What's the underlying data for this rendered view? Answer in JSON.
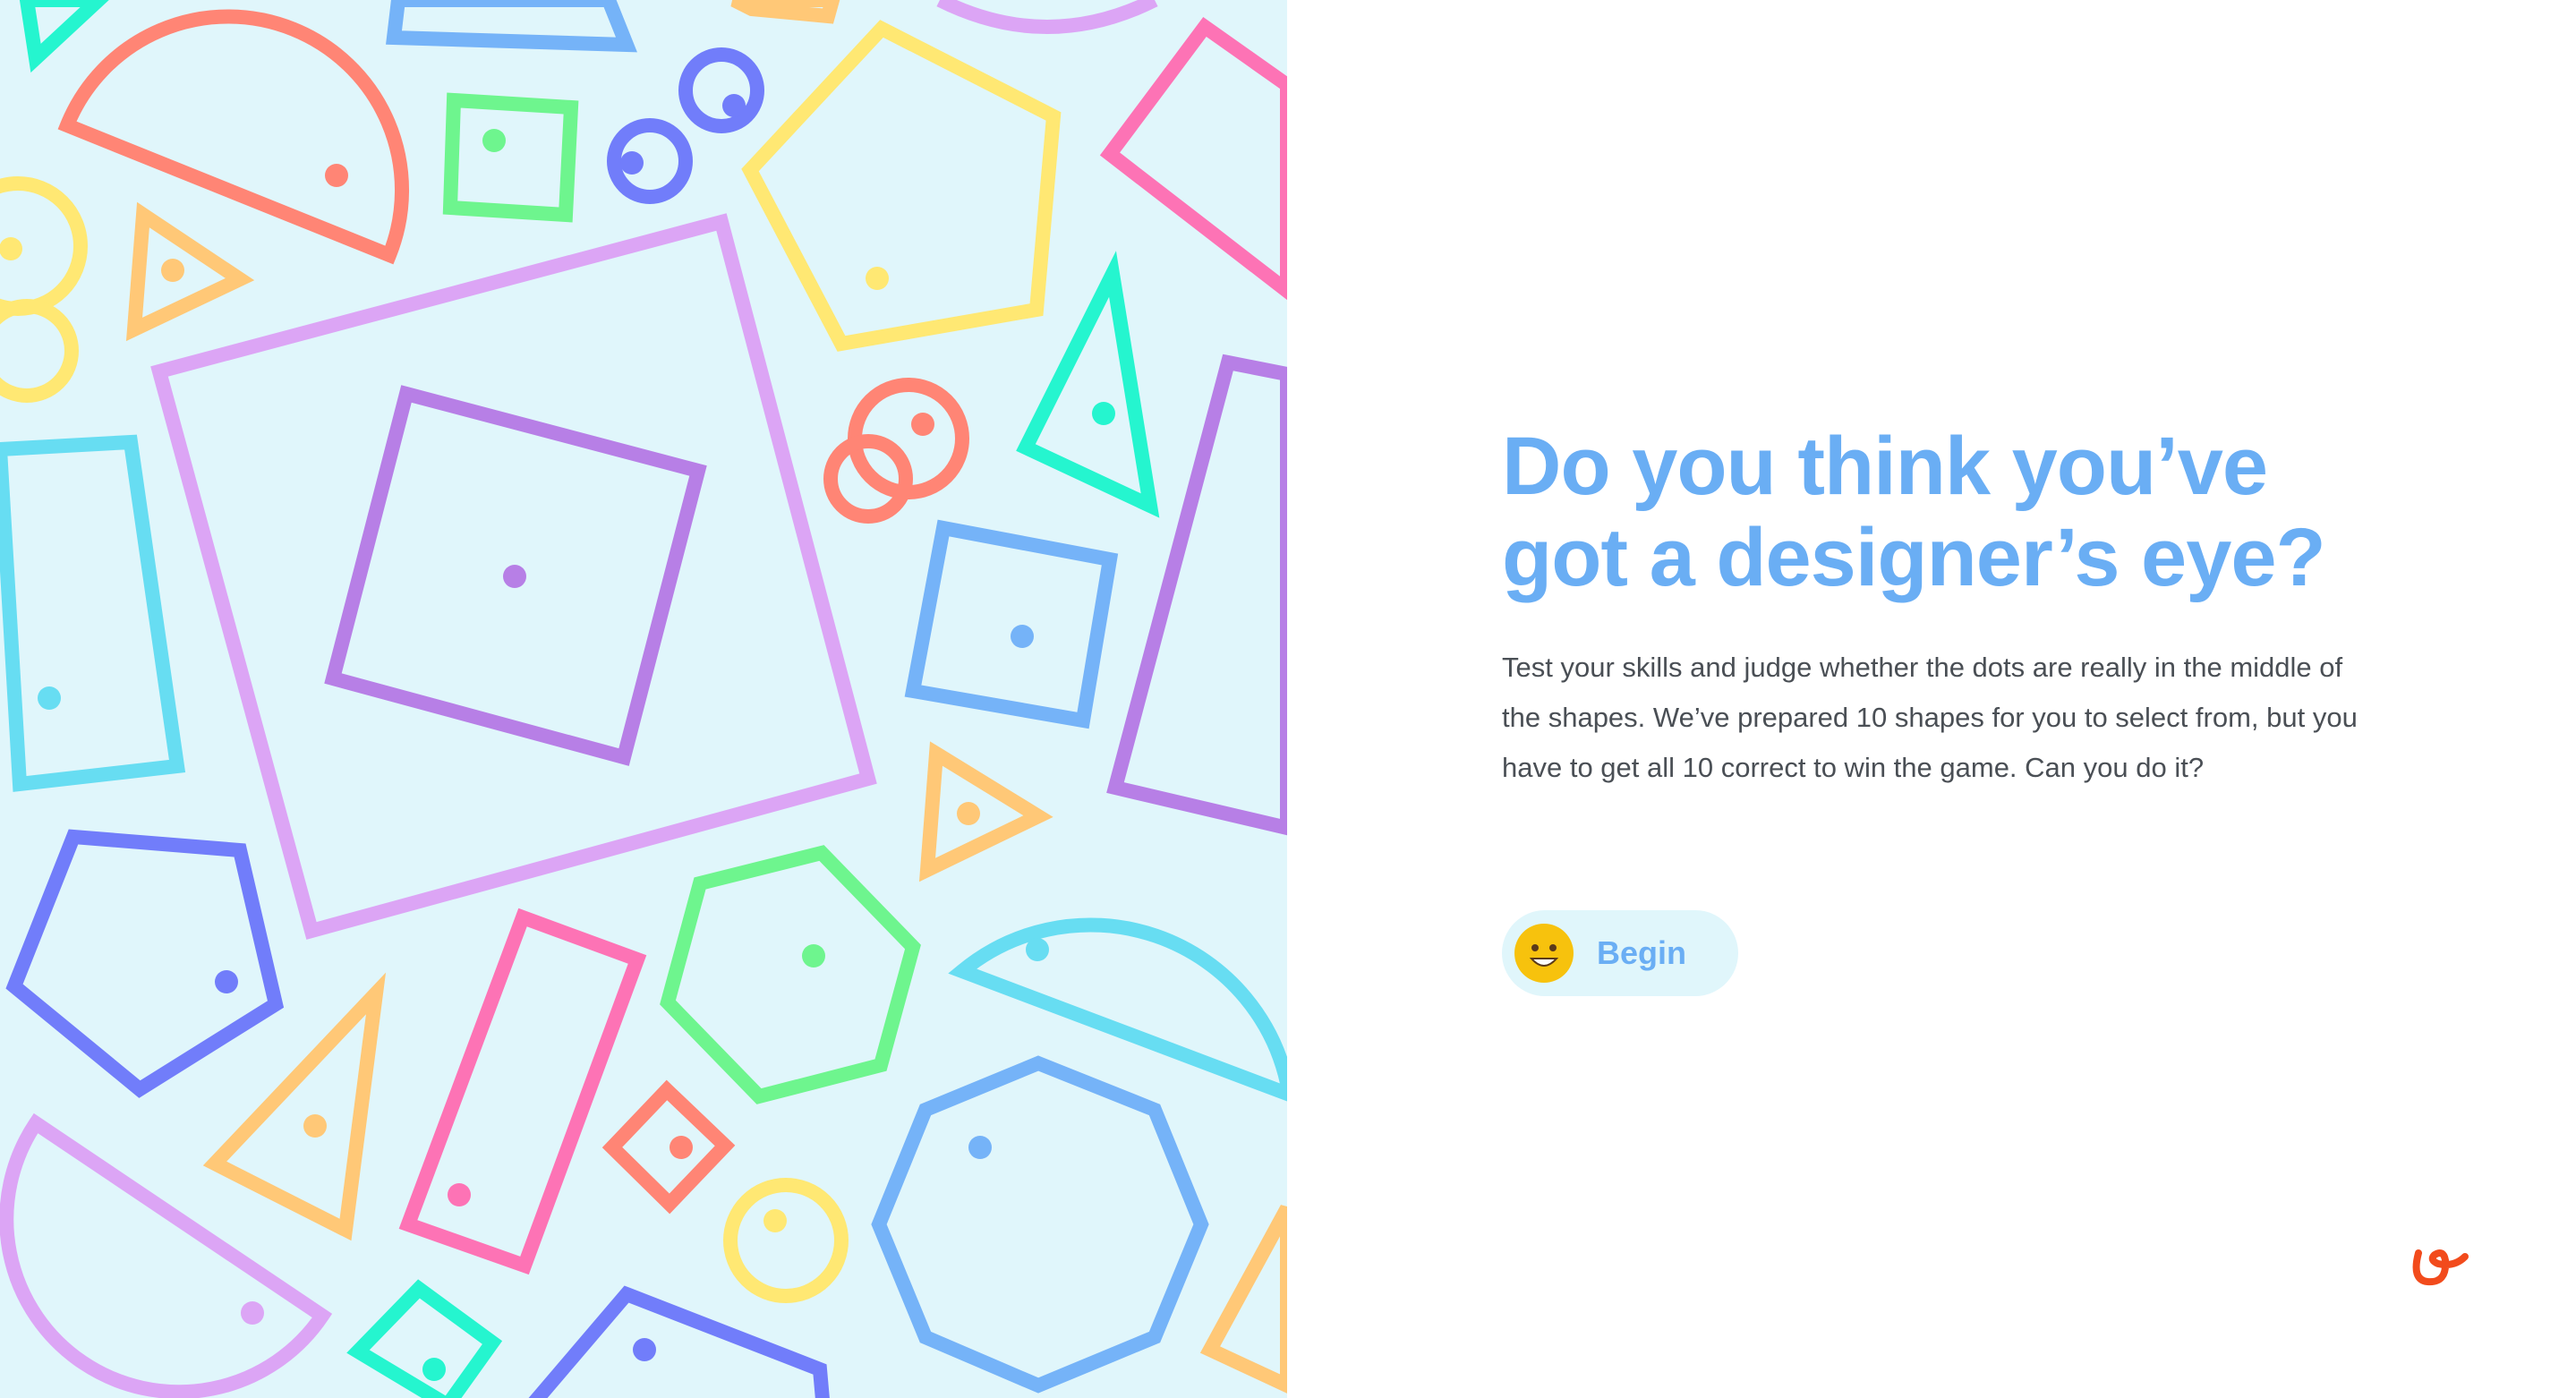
{
  "colors": {
    "canvas": "#e0f6fb",
    "heading": "#6aaef4",
    "body": "#4a4f55",
    "button_bg": "#e0f6fb",
    "button_text": "#6aaef4",
    "smiley": "#f7c20d",
    "brand": "#f24b1c",
    "coral": "#ff8575",
    "lavender": "#dca5f5",
    "purple": "#b77fe6",
    "blue": "#75b3f8",
    "indigo": "#717dfa",
    "cyan": "#67ddf2",
    "mint": "#25f5cf",
    "green": "#6ef58e",
    "yellow": "#ffe873",
    "orange": "#ffc877",
    "pink": "#fd73b5"
  },
  "intro": {
    "title_line1": "Do you think you’ve",
    "title_line2": "got a designer’s eye?",
    "description": "Test your skills and judge whether the dots are really in the middle of the shapes. We’ve prepared 10 shapes for you to select from, but you have to get all 10 correct to win the game. Can you do it?"
  },
  "begin_button": {
    "label": "Begin",
    "icon": "smiley-icon"
  },
  "brand": {
    "icon": "brand-logo-icon"
  },
  "illustration": {
    "icon": "shape-pattern-illustration"
  }
}
